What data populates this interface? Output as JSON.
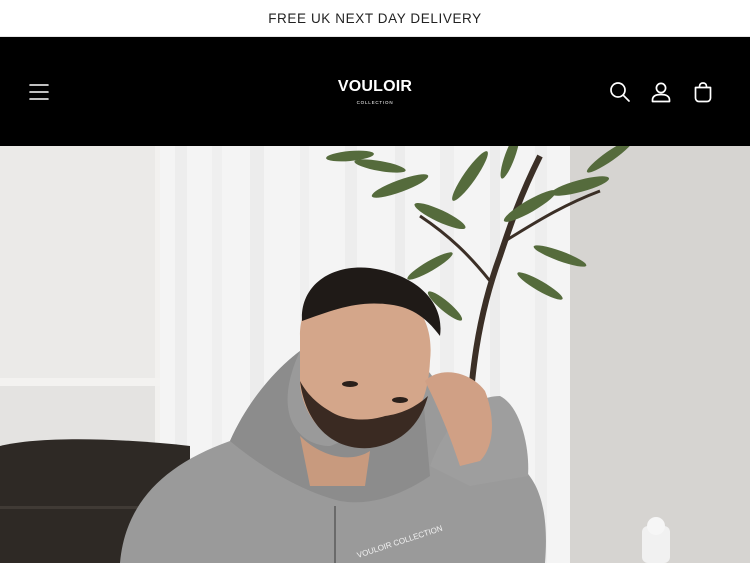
{
  "announcement": {
    "text": "FREE UK NEXT DAY DELIVERY"
  },
  "header": {
    "logo_main": "VOULOIR",
    "logo_sub": "COLLECTION",
    "background_color": "#000000",
    "icon_color": "#ffffff",
    "icons": [
      "menu-icon",
      "search-icon",
      "account-icon",
      "cart-icon"
    ]
  },
  "hero": {
    "hoodie_print": "VOULOIR COLLECTION"
  }
}
